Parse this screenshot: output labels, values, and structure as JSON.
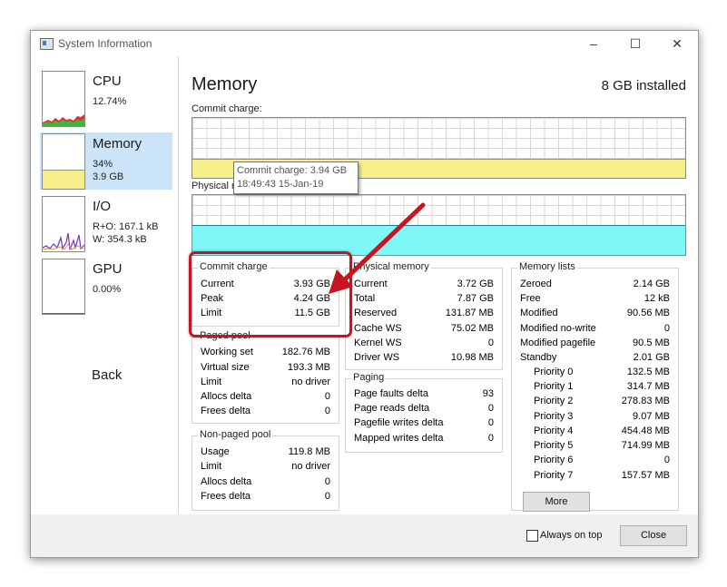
{
  "window": {
    "title": "System Information"
  },
  "sidebar": {
    "items": [
      {
        "name": "CPU",
        "line1": "12.74%",
        "line2": ""
      },
      {
        "name": "Memory",
        "line1": "34%",
        "line2": "3.9 GB"
      },
      {
        "name": "I/O",
        "line1": "R+O: 167.1 kB",
        "line2": "W: 354.3 kB"
      },
      {
        "name": "GPU",
        "line1": "0.00%",
        "line2": ""
      }
    ],
    "back_label": "Back"
  },
  "main": {
    "title": "Memory",
    "installed": "8 GB installed",
    "commit_graph_label": "Commit charge:",
    "physical_graph_label": "Physical memory:",
    "commit_fill_fraction": 0.49,
    "physical_fill_fraction": 0.49,
    "colors": {
      "commit": "#f7ef8c",
      "physical": "#7ff7f7",
      "physical_line": "#1b7f9a"
    }
  },
  "tooltip": {
    "line1": "Commit charge: 3.94 GB",
    "line2": "18:49:43 15-Jan-19"
  },
  "commit_charge": {
    "title": "Commit charge",
    "rows": [
      {
        "k": "Current",
        "v": "3.93 GB"
      },
      {
        "k": "Peak",
        "v": "4.24 GB"
      },
      {
        "k": "Limit",
        "v": "11.5 GB"
      }
    ]
  },
  "paged_pool": {
    "title": "Paged pool",
    "rows": [
      {
        "k": "Working set",
        "v": "182.76 MB"
      },
      {
        "k": "Virtual size",
        "v": "193.3 MB"
      },
      {
        "k": "Limit",
        "v": "no driver"
      },
      {
        "k": "Allocs delta",
        "v": "0"
      },
      {
        "k": "Frees delta",
        "v": "0"
      }
    ]
  },
  "nonpaged_pool": {
    "title": "Non-paged pool",
    "rows": [
      {
        "k": "Usage",
        "v": "119.8 MB"
      },
      {
        "k": "Limit",
        "v": "no driver"
      },
      {
        "k": "Allocs delta",
        "v": "0"
      },
      {
        "k": "Frees delta",
        "v": "0"
      }
    ]
  },
  "physical_memory": {
    "title": "Physical memory",
    "rows": [
      {
        "k": "Current",
        "v": "3.72 GB"
      },
      {
        "k": "Total",
        "v": "7.87 GB"
      },
      {
        "k": "Reserved",
        "v": "131.87 MB"
      },
      {
        "k": "Cache WS",
        "v": "75.02 MB"
      },
      {
        "k": "Kernel WS",
        "v": "0"
      },
      {
        "k": "Driver WS",
        "v": "10.98 MB"
      }
    ]
  },
  "paging": {
    "title": "Paging",
    "rows": [
      {
        "k": "Page faults delta",
        "v": "93"
      },
      {
        "k": "Page reads delta",
        "v": "0"
      },
      {
        "k": "Pagefile writes delta",
        "v": "0"
      },
      {
        "k": "Mapped writes delta",
        "v": "0"
      }
    ]
  },
  "memory_lists": {
    "title": "Memory lists",
    "rows": [
      {
        "k": "Zeroed",
        "v": "2.14 GB"
      },
      {
        "k": "Free",
        "v": "12 kB"
      },
      {
        "k": "Modified",
        "v": "90.56 MB"
      },
      {
        "k": "Modified no-write",
        "v": "0"
      },
      {
        "k": "Modified pagefile",
        "v": "90.5 MB"
      },
      {
        "k": "Standby",
        "v": "2.01 GB"
      },
      {
        "k": "Priority 0",
        "v": "132.5 MB",
        "sub": true
      },
      {
        "k": "Priority 1",
        "v": "314.7 MB",
        "sub": true
      },
      {
        "k": "Priority 2",
        "v": "278.83 MB",
        "sub": true
      },
      {
        "k": "Priority 3",
        "v": "9.07 MB",
        "sub": true
      },
      {
        "k": "Priority 4",
        "v": "454.48 MB",
        "sub": true
      },
      {
        "k": "Priority 5",
        "v": "714.99 MB",
        "sub": true
      },
      {
        "k": "Priority 6",
        "v": "0",
        "sub": true
      },
      {
        "k": "Priority 7",
        "v": "157.57 MB",
        "sub": true
      }
    ],
    "more_label": "More"
  },
  "footer": {
    "always_on_top_label": "Always on top",
    "always_on_top_checked": false,
    "close_label": "Close"
  },
  "icons": [
    "app-icon",
    "minimize-icon",
    "maximize-icon",
    "close-icon",
    "annotation-arrow"
  ]
}
